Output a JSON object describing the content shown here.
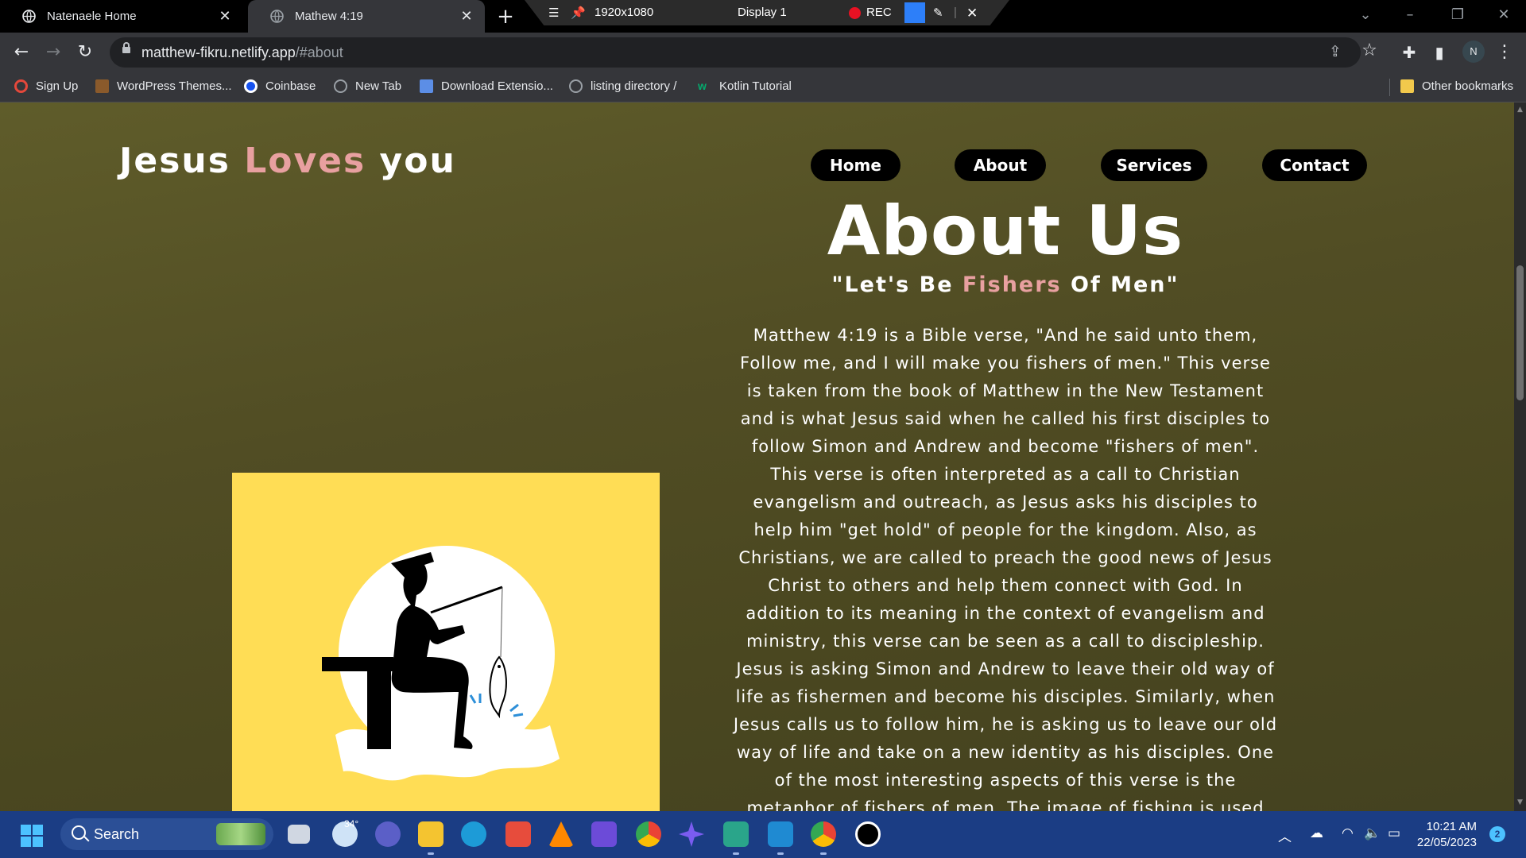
{
  "browser": {
    "tabs": [
      {
        "title": "Natenaele Home"
      },
      {
        "title": "Mathew 4:19"
      }
    ],
    "recorder": {
      "resolution": "1920x1080",
      "display": "Display 1",
      "rec_label": "REC"
    },
    "url_host": "matthew-fikru.netlify.app",
    "url_path": "/#about",
    "profile_initial": "N",
    "bookmarks": [
      {
        "label": "Sign Up",
        "icon": "opera-icon",
        "color": "#e5483b"
      },
      {
        "label": "WordPress Themes...",
        "icon": "wordpress-icon",
        "color": "#8a5a2b"
      },
      {
        "label": "Coinbase",
        "icon": "coinbase-icon",
        "color": "#1652f0"
      },
      {
        "label": "New Tab",
        "icon": "globe-icon",
        "color": "#9aa0a6"
      },
      {
        "label": "Download Extensio...",
        "icon": "extension-icon",
        "color": "#5c8ee6"
      },
      {
        "label": "listing directory /",
        "icon": "globe-icon",
        "color": "#9aa0a6"
      },
      {
        "label": "Kotlin Tutorial",
        "icon": "w3-icon",
        "color": "#04aa6d"
      }
    ],
    "other_bookmarks": "Other bookmarks"
  },
  "page": {
    "brand": {
      "part1": "Jesus ",
      "accent": "Loves",
      "part2": " you"
    },
    "nav": [
      {
        "label": "Home"
      },
      {
        "label": "About"
      },
      {
        "label": "Services"
      },
      {
        "label": "Contact"
      }
    ],
    "about": {
      "title": "About Us",
      "subtitle_part1": "\"Let's Be ",
      "subtitle_accent": "Fishers",
      "subtitle_part2": " Of Men\"",
      "body": "Matthew 4:19 is a Bible verse, \"And he said unto them, Follow me, and I will make you fishers of men.\" This verse is taken from the book of Matthew in the New Testament and is what Jesus said when he called his first disciples to follow Simon and Andrew and become \"fishers of men\". This verse is often interpreted as a call to Christian evangelism and outreach, as Jesus asks his disciples to help him \"get hold\" of people for the kingdom. Also, as Christians, we are called to preach the good news of Jesus Christ to others and help them connect with God. In addition to its meaning in the context of evangelism and ministry, this verse can be seen as a call to discipleship. Jesus is asking Simon and Andrew to leave their old way of life as fishermen and become his disciples. Similarly, when Jesus calls us to follow him, he is asking us to leave our old way of life and take on a new identity as his disciples. One of the most interesting aspects of this verse is the metaphor of fishers of men. The image of fishing is used many times in the Bible to represent the"
    },
    "colors": {
      "accent": "#e8a0a0",
      "art_bg": "#ffdd55",
      "nav_bg": "#000000"
    }
  },
  "taskbar": {
    "search_label": "Search",
    "weather_temp": "34°",
    "time": "10:21 AM",
    "date": "22/05/2023",
    "notification_count": "2"
  }
}
